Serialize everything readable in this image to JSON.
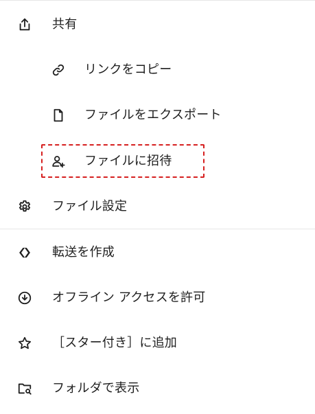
{
  "menu": {
    "items": [
      {
        "label": "共有",
        "icon": "share-icon"
      },
      {
        "label": "リンクをコピー",
        "icon": "link-icon"
      },
      {
        "label": "ファイルをエクスポート",
        "icon": "file-icon"
      },
      {
        "label": "ファイルに招待",
        "icon": "add-person-icon"
      },
      {
        "label": "ファイル設定",
        "icon": "gear-icon"
      },
      {
        "label": "転送を作成",
        "icon": "transfer-icon"
      },
      {
        "label": "オフライン アクセスを許可",
        "icon": "download-circle-icon"
      },
      {
        "label": "［スター付き］に追加",
        "icon": "star-icon"
      },
      {
        "label": "フォルダで表示",
        "icon": "folder-search-icon"
      }
    ]
  },
  "highlight": {
    "color": "#d61f1f",
    "target": "ファイルに招待"
  },
  "colors": {
    "text": "#1f1f1f",
    "icon": "#1f1f1f",
    "divider": "#e6e6e6"
  }
}
